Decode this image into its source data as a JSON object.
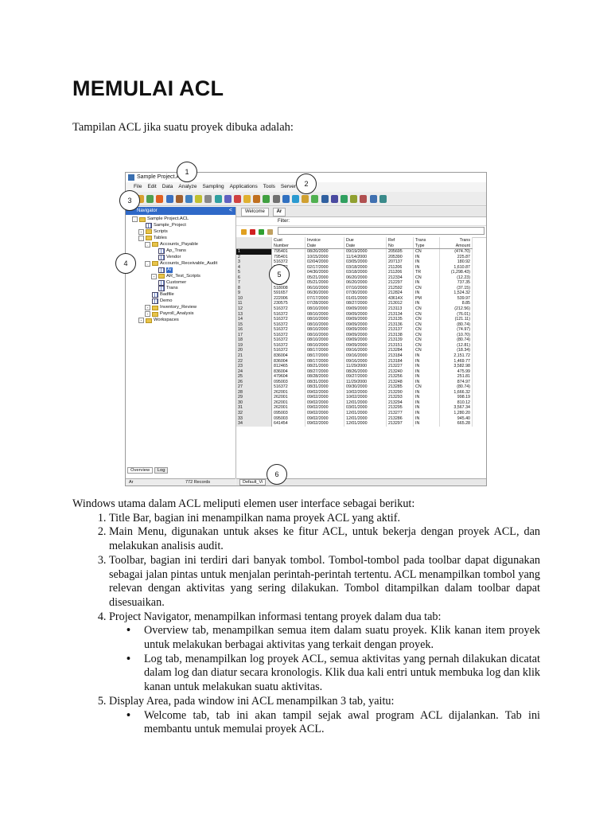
{
  "heading": "MEMULAI ACL",
  "intro": "Tampilan ACL jika suatu proyek dibuka adalah:",
  "screenshot": {
    "window_title": "Sample Project.ACL",
    "menu": [
      "File",
      "Edit",
      "Data",
      "Analyze",
      "Sampling",
      "Applications",
      "Tools",
      "Server",
      "Help"
    ],
    "navigator_title": "Navigator",
    "tree": [
      {
        "label": "Sample Project.ACL",
        "level": 0,
        "icon": "folder",
        "toggle": "-"
      },
      {
        "label": "Sample_Project",
        "level": 1,
        "icon": "table",
        "toggle": ""
      },
      {
        "label": "Scripts",
        "level": 1,
        "icon": "folder",
        "toggle": "+"
      },
      {
        "label": "Tables",
        "level": 1,
        "icon": "folder",
        "toggle": "-"
      },
      {
        "label": "Accounts_Payable",
        "level": 2,
        "icon": "folder",
        "toggle": "-"
      },
      {
        "label": "Ap_Trans",
        "level": 3,
        "icon": "table",
        "toggle": ""
      },
      {
        "label": "Vendor",
        "level": 3,
        "icon": "table",
        "toggle": ""
      },
      {
        "label": "Accounts_Receivable_Audit",
        "level": 2,
        "icon": "folder",
        "toggle": "-"
      },
      {
        "label": "Ar",
        "level": 3,
        "icon": "table",
        "toggle": "",
        "selected": true
      },
      {
        "label": "AR_Test_Scripts",
        "level": 3,
        "icon": "folder",
        "toggle": "+"
      },
      {
        "label": "Customer",
        "level": 3,
        "icon": "table",
        "toggle": ""
      },
      {
        "label": "Trans",
        "level": 3,
        "icon": "table",
        "toggle": ""
      },
      {
        "label": "Badfile",
        "level": 2,
        "icon": "table",
        "toggle": ""
      },
      {
        "label": "Demo",
        "level": 2,
        "icon": "table",
        "toggle": ""
      },
      {
        "label": "Inventory_Review",
        "level": 2,
        "icon": "folder",
        "toggle": "+"
      },
      {
        "label": "Payroll_Analysis",
        "level": 2,
        "icon": "folder",
        "toggle": "+"
      },
      {
        "label": "Workspaces",
        "level": 1,
        "icon": "folder",
        "toggle": "+"
      }
    ],
    "nav_tabs": [
      "Overview",
      "Log"
    ],
    "status_table": "Ar",
    "status_records": "772 Records",
    "display_tabs": [
      "Welcome",
      "Ar"
    ],
    "filter_label": "Filter:",
    "columns": [
      [
        "Cust",
        "Number"
      ],
      [
        "Invoice",
        "Date"
      ],
      [
        "Due",
        "Date"
      ],
      [
        "Ref",
        "No"
      ],
      [
        "Trans",
        "Type"
      ],
      [
        "Trans",
        "Amount"
      ]
    ],
    "rows": [
      [
        "1",
        "795401",
        "08/20/2000",
        "09/19/2000",
        "205695",
        "CN",
        "(474.70)"
      ],
      [
        "2",
        "795401",
        "10/15/2000",
        "11/14/2000",
        "205390",
        "IN",
        "225.87"
      ],
      [
        "3",
        "516372",
        "02/04/2000",
        "03/05/2000",
        "207137",
        "IN",
        "180.92"
      ],
      [
        "4",
        "516372",
        "02/17/2000",
        "03/18/2000",
        "211206",
        "IN",
        "1,610.87"
      ],
      [
        "5",
        "516372",
        "04/30/2000",
        "03/18/2000",
        "211206",
        "TR",
        "(1,298.43)"
      ],
      [
        "6",
        "718008",
        "05/21/2000",
        "06/20/2000",
        "212334",
        "CN",
        "(12.23)"
      ],
      [
        "7",
        "784647",
        "05/21/2000",
        "06/20/2000",
        "212297",
        "IN",
        "737.35"
      ],
      [
        "8",
        "518008",
        "06/10/2000",
        "07/10/2000",
        "212592",
        "CN",
        "(37.15)"
      ],
      [
        "9",
        "591657",
        "06/30/2000",
        "07/30/2000",
        "212824",
        "IN",
        "1,524.32"
      ],
      [
        "10",
        "222006",
        "07/17/2000",
        "01/01/2000",
        "43614X",
        "PM",
        "539.97"
      ],
      [
        "11",
        "230575",
        "07/28/2000",
        "08/27/2000",
        "213012",
        "IN",
        "8.85"
      ],
      [
        "12",
        "516372",
        "08/10/2000",
        "09/09/2000",
        "213113",
        "CN",
        "(212.56)"
      ],
      [
        "13",
        "516372",
        "08/10/2000",
        "09/09/2000",
        "213134",
        "CN",
        "(76.01)"
      ],
      [
        "14",
        "516372",
        "08/10/2000",
        "09/09/2000",
        "213135",
        "CN",
        "(121.11)"
      ],
      [
        "15",
        "516372",
        "08/10/2000",
        "09/09/2000",
        "213136",
        "CN",
        "(80.74)"
      ],
      [
        "16",
        "516372",
        "08/10/2000",
        "09/09/2000",
        "213137",
        "CN",
        "(74.97)"
      ],
      [
        "17",
        "516372",
        "08/10/2000",
        "09/09/2000",
        "213138",
        "CN",
        "(10.70)"
      ],
      [
        "18",
        "516372",
        "08/10/2000",
        "09/09/2000",
        "213139",
        "CN",
        "(80.74)"
      ],
      [
        "19",
        "516372",
        "08/10/2000",
        "09/09/2000",
        "213151",
        "CN",
        "(12.81)"
      ],
      [
        "20",
        "516372",
        "08/17/2000",
        "09/16/2000",
        "213284",
        "CN",
        "(18.34)"
      ],
      [
        "21",
        "836004",
        "08/17/2000",
        "09/16/2000",
        "213184",
        "IN",
        "2,151.72"
      ],
      [
        "22",
        "836004",
        "08/17/2000",
        "09/16/2000",
        "213184",
        "IN",
        "1,469.77"
      ],
      [
        "23",
        "812465",
        "08/21/2000",
        "11/29/2000",
        "213227",
        "IN",
        "3,582.98"
      ],
      [
        "24",
        "836004",
        "08/27/2000",
        "08/26/2000",
        "213240",
        "IN",
        "475.99"
      ],
      [
        "25",
        "479604",
        "08/28/2000",
        "09/27/2000",
        "213256",
        "IN",
        "251.81"
      ],
      [
        "26",
        "095003",
        "08/31/2000",
        "11/29/2000",
        "213248",
        "IN",
        "874.97"
      ],
      [
        "27",
        "516372",
        "08/31/2000",
        "09/30/2000",
        "213285",
        "CN",
        "(80.74)"
      ],
      [
        "28",
        "262001",
        "09/02/2000",
        "10/02/2000",
        "213290",
        "IN",
        "1,666.32"
      ],
      [
        "29",
        "262001",
        "09/02/2000",
        "10/02/2000",
        "213293",
        "IN",
        "998.19"
      ],
      [
        "30",
        "262001",
        "09/02/2000",
        "12/01/2000",
        "213294",
        "IN",
        "810.12"
      ],
      [
        "31",
        "262001",
        "09/02/2000",
        "03/01/2000",
        "213295",
        "IN",
        "3,567.34"
      ],
      [
        "32",
        "095003",
        "09/02/2000",
        "12/01/2000",
        "213277",
        "IN",
        "1,280.20"
      ],
      [
        "33",
        "095003",
        "09/02/2000",
        "12/01/2000",
        "213286",
        "IN",
        "945.40"
      ],
      [
        "34",
        "641454",
        "09/02/2000",
        "12/01/2000",
        "213297",
        "IN",
        "665.28"
      ]
    ],
    "view_tab": "Default_Vi",
    "callouts": [
      "1",
      "2",
      "3",
      "4",
      "5",
      "6"
    ]
  },
  "body": {
    "lead": "Windows utama dalam ACL meliputi elemen user interface sebagai berikut:",
    "items": [
      "Title Bar, bagian ini menampilkan nama proyek ACL yang aktif.",
      "Main Menu, digunakan untuk akses ke fitur ACL, untuk bekerja dengan proyek ACL, dan melakukan analisis audit.",
      "Toolbar, bagian ini terdiri dari banyak tombol. Tombol-tombol pada toolbar dapat digunakan sebagai jalan pintas untuk menjalan perintah-perintah tertentu. ACL menampilkan tombol yang relevan dengan aktivitas yang sering dilakukan. Tombol ditampilkan dalam toolbar dapat disesuaikan.",
      "Project Navigator, menampilkan informasi tentang proyek dalam dua tab:",
      "Display Area, pada window ini ACL menampilkan 3 tab, yaitu:"
    ],
    "navigator_bullets": [
      "Overview tab, menampilkan semua item dalam suatu proyek. Klik kanan item proyek untuk melakukan berbagai aktivitas yang terkait dengan proyek.",
      "Log tab, menampilkan log proyek ACL, semua aktivitas yang pernah dilakukan dicatat dalam log dan diatur secara kronologis. Klik dua kali entri untuk membuka log dan klik kanan untuk melakukan suatu aktivitas."
    ],
    "display_bullets": [
      "Welcome tab, tab ini akan tampil sejak awal program ACL dijalankan. Tab ini membantu untuk memulai proyek ACL."
    ]
  }
}
